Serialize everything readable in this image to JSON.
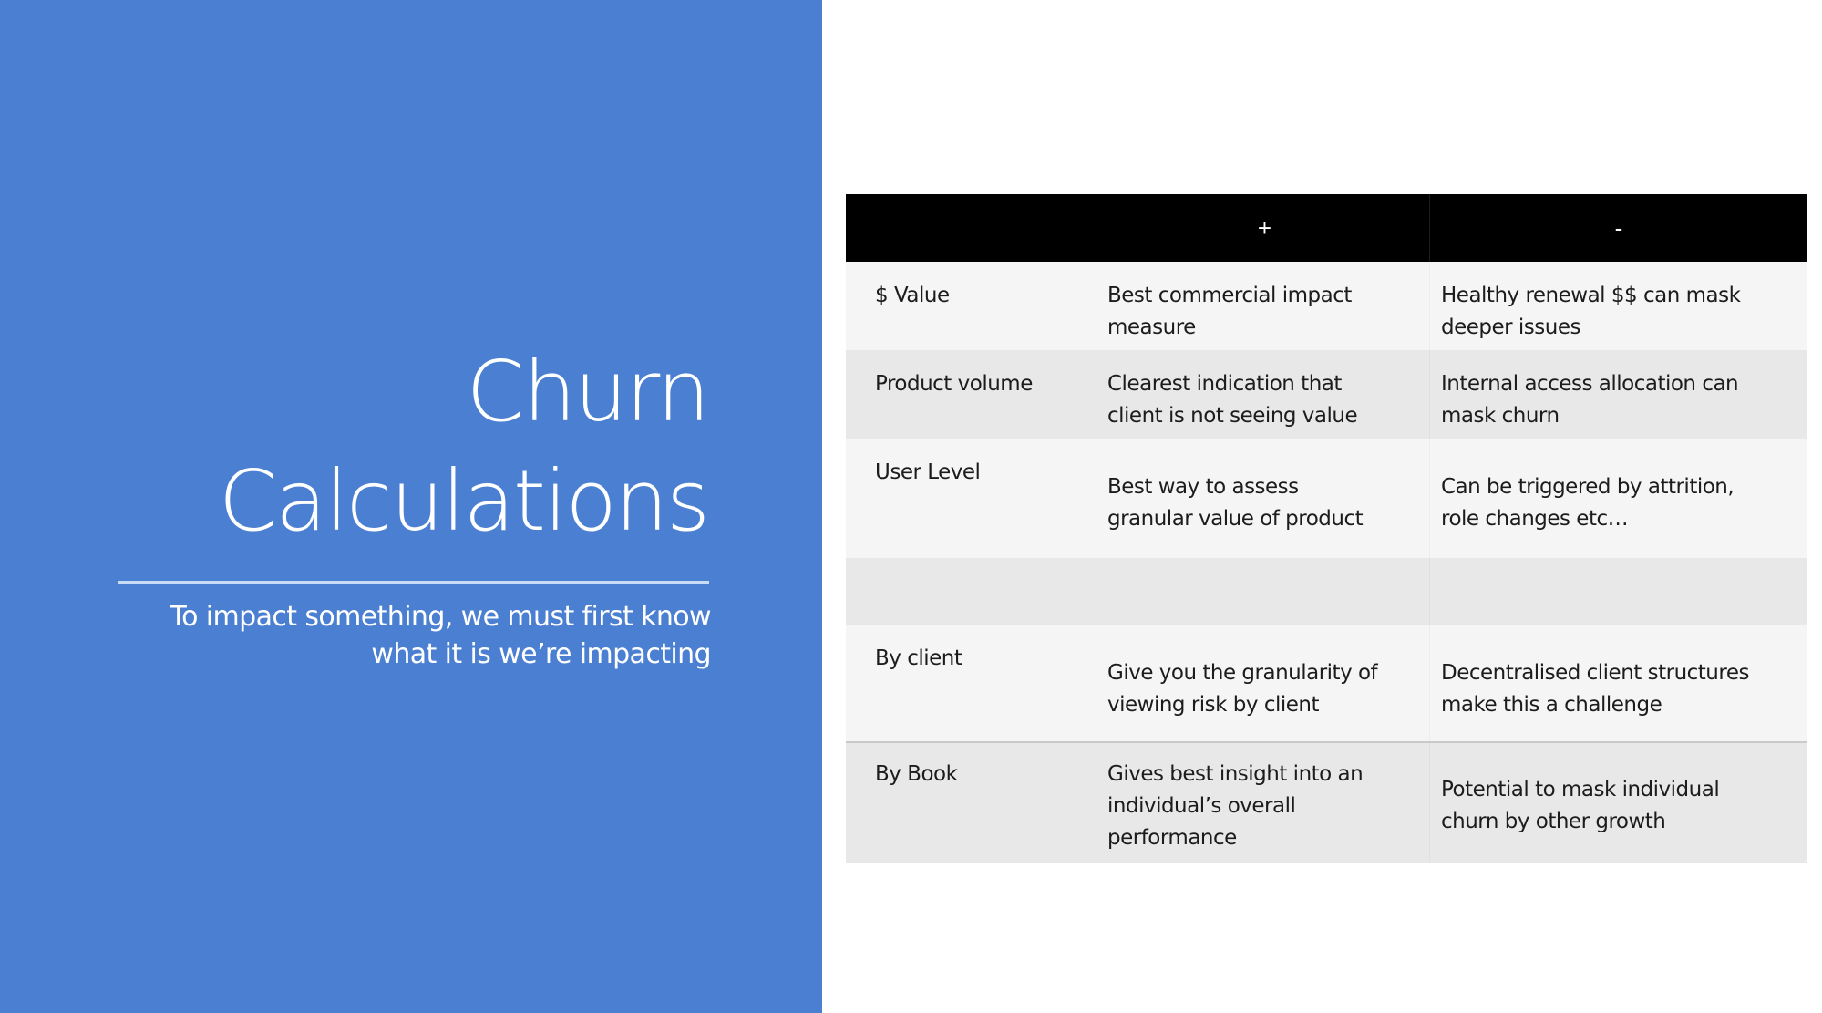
{
  "slide": {
    "title_lines": [
      "Churn",
      "Calculations"
    ],
    "subtitle_lines": [
      "To impact something, we must first know",
      "what it is we’re impacting"
    ],
    "accent_color": "#4a7fd1"
  },
  "table": {
    "headers": [
      "",
      "+",
      "-"
    ],
    "rows": [
      {
        "label": "$ Value",
        "plus": [
          "Best commercial impact",
          "measure"
        ],
        "minus": [
          "Healthy renewal $$ can mask",
          "deeper issues"
        ]
      },
      {
        "label": "Product volume",
        "plus": [
          "Clearest indication that",
          "client is not seeing value"
        ],
        "minus": [
          "Internal access allocation can",
          "mask churn"
        ]
      },
      {
        "label": "User Level",
        "plus": [
          "Best way to assess",
          "granular value of product"
        ],
        "minus": [
          "Can be triggered by attrition,",
          "role changes etc…"
        ]
      },
      {
        "label": "",
        "plus": [],
        "minus": []
      },
      {
        "label": "By client",
        "plus": [
          "Give you the granularity of",
          "viewing risk by client"
        ],
        "minus": [
          "Decentralised client structures",
          "make this a challenge"
        ]
      },
      {
        "label": "By Book",
        "plus": [
          "Gives best insight into an",
          "individual’s overall",
          "performance"
        ],
        "minus": [
          "Potential to mask individual",
          "churn by other growth"
        ]
      }
    ]
  }
}
